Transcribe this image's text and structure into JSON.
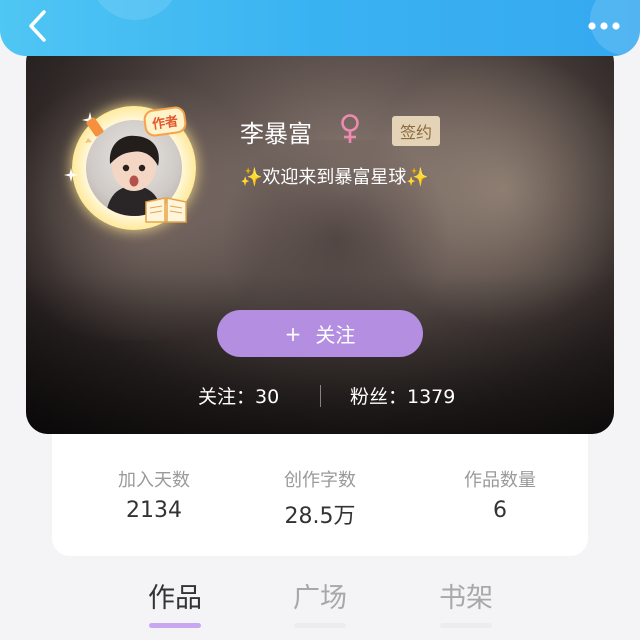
{
  "nav": {
    "back_icon": "chevron-left-icon",
    "more_icon": "more-dots-icon"
  },
  "profile": {
    "name": "李暴富",
    "gender_icon": "female-icon",
    "signed_badge": "签约",
    "author_tag": "作者",
    "motto": "✨欢迎来到暴富星球✨",
    "follow_button": {
      "plus": "+",
      "label": "关注"
    },
    "following_text": "关注：30",
    "fans_text": "粉丝：1379"
  },
  "stats": [
    {
      "label": "加入天数",
      "value": "2134"
    },
    {
      "label": "创作字数",
      "value": "28.5万"
    },
    {
      "label": "作品数量",
      "value": "6"
    }
  ],
  "tabs": [
    {
      "label": "作品",
      "active": true
    },
    {
      "label": "广场",
      "active": false
    },
    {
      "label": "书架",
      "active": false
    }
  ],
  "colors": {
    "nav_gradient_start": "#4fc6f3",
    "nav_gradient_end": "#36a9f0",
    "follow_button": "#b48ee0",
    "active_underline": "#c9a6f0",
    "gender_icon": "#f08ab0",
    "signed_badge_bg": "#e4d3b6"
  }
}
